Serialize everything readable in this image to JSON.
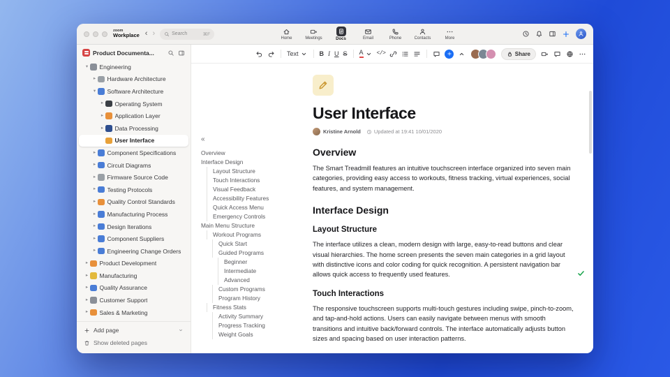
{
  "colors": {
    "accent": "#1a6ef5",
    "check_green": "#17a34a",
    "workspace_red": "#d64444"
  },
  "titlebar": {
    "logo_top": "zoom",
    "logo_bottom": "Workplace",
    "back_glyph": "‹",
    "forward_glyph": "›",
    "search_placeholder": "Search",
    "search_shortcut": "⌘F",
    "tabs": [
      {
        "label": "Home",
        "icon": "home",
        "active": false
      },
      {
        "label": "Meetings",
        "icon": "video",
        "active": false
      },
      {
        "label": "Docs",
        "icon": "doc",
        "active": true
      },
      {
        "label": "Email",
        "icon": "email",
        "active": false
      },
      {
        "label": "Phone",
        "icon": "phone",
        "active": false
      },
      {
        "label": "Contacts",
        "icon": "person",
        "active": false
      },
      {
        "label": "More",
        "icon": "dots",
        "active": false
      }
    ]
  },
  "sidebar": {
    "workspace_title": "Product Documenta...",
    "tree": [
      {
        "label": "Engineering",
        "level": 0,
        "chevron": "expanded",
        "color": "#8a8f98"
      },
      {
        "label": "Hardware Architecture",
        "level": 1,
        "chevron": "collapsed",
        "color": "#9aa0a6"
      },
      {
        "label": "Software Architecture",
        "level": 1,
        "chevron": "expanded",
        "color": "#4a7dd6"
      },
      {
        "label": "Operating System",
        "level": 2,
        "chevron": "collapsed",
        "color": "#3b3f45"
      },
      {
        "label": "Application Layer",
        "level": 2,
        "chevron": "collapsed",
        "color": "#e8903a"
      },
      {
        "label": "Data Processing",
        "level": 2,
        "chevron": "collapsed",
        "color": "#2f4f8f"
      },
      {
        "label": "User Interface",
        "level": 2,
        "chevron": "none",
        "color": "#e8a13a",
        "selected": true
      },
      {
        "label": "Component Specifications",
        "level": 1,
        "chevron": "collapsed",
        "color": "#4a7dd6"
      },
      {
        "label": "Circuit Diagrams",
        "level": 1,
        "chevron": "collapsed",
        "color": "#4a7dd6"
      },
      {
        "label": "Firmware Source Code",
        "level": 1,
        "chevron": "collapsed",
        "color": "#9aa0a6"
      },
      {
        "label": "Testing Protocols",
        "level": 1,
        "chevron": "collapsed",
        "color": "#4a7dd6"
      },
      {
        "label": "Quality Control Standards",
        "level": 1,
        "chevron": "collapsed",
        "color": "#e8903a"
      },
      {
        "label": "Manufacturing Process",
        "level": 1,
        "chevron": "collapsed",
        "color": "#4a7dd6"
      },
      {
        "label": "Design Iterations",
        "level": 1,
        "chevron": "collapsed",
        "color": "#4a7dd6"
      },
      {
        "label": "Component Suppliers",
        "level": 1,
        "chevron": "collapsed",
        "color": "#4a7dd6"
      },
      {
        "label": "Engineering Change Orders",
        "level": 1,
        "chevron": "collapsed",
        "color": "#4a7dd6"
      },
      {
        "label": "Product Development",
        "level": 0,
        "chevron": "collapsed",
        "color": "#e8903a"
      },
      {
        "label": "Manufacturing",
        "level": 0,
        "chevron": "collapsed",
        "color": "#e3b93c"
      },
      {
        "label": "Quality Assurance",
        "level": 0,
        "chevron": "collapsed",
        "color": "#4a7dd6"
      },
      {
        "label": "Customer Support",
        "level": 0,
        "chevron": "collapsed",
        "color": "#8a8f98"
      },
      {
        "label": "Sales & Marketing",
        "level": 0,
        "chevron": "collapsed",
        "color": "#e8903a"
      }
    ],
    "add_page": "Add page",
    "show_deleted": "Show deleted pages"
  },
  "toolbar": {
    "share_label": "Share",
    "avatars": [
      "#9a6b4f",
      "#7b8794",
      "#d48fb0"
    ],
    "left_items": [
      {
        "name": "undo",
        "icon": "undo"
      },
      {
        "name": "redo",
        "icon": "redo"
      },
      {
        "name": "divider"
      },
      {
        "name": "text-style",
        "text": "Text",
        "icon": "caret"
      },
      {
        "name": "divider"
      },
      {
        "name": "bold",
        "text": "B",
        "style": "bold"
      },
      {
        "name": "italic",
        "text": "I",
        "style": "italic"
      },
      {
        "name": "underline",
        "text": "U",
        "style": "underline"
      },
      {
        "name": "strikethrough",
        "text": "S",
        "style": "strike"
      },
      {
        "name": "divider"
      },
      {
        "name": "text-color",
        "text": "A",
        "icon": "caret",
        "style": "color"
      },
      {
        "name": "code",
        "text": "</>",
        "style": "codebtn"
      },
      {
        "name": "link",
        "icon": "link"
      },
      {
        "name": "bullet-list",
        "icon": "list"
      },
      {
        "name": "align",
        "icon": "align"
      },
      {
        "name": "divider"
      },
      {
        "name": "comment",
        "icon": "comment"
      },
      {
        "name": "insert",
        "icon": "plus",
        "style": "plusbtn"
      },
      {
        "name": "collapse-toolbar",
        "icon": "chevup"
      }
    ]
  },
  "outline": {
    "collapse_glyph": "«",
    "items": [
      {
        "label": "Overview",
        "level": 0
      },
      {
        "label": "Interface Design",
        "level": 0
      },
      {
        "label": "Layout Structure",
        "level": 1
      },
      {
        "label": "Touch Interactions",
        "level": 1
      },
      {
        "label": "Visual Feedback",
        "level": 1
      },
      {
        "label": "Accessibility Features",
        "level": 1
      },
      {
        "label": "Quick Access Menu",
        "level": 1
      },
      {
        "label": "Emergency Controls",
        "level": 1
      },
      {
        "label": "Main Menu Structure",
        "level": 0
      },
      {
        "label": "Workout Programs",
        "level": 1
      },
      {
        "label": "Quick Start",
        "level": 2
      },
      {
        "label": "Guided Programs",
        "level": 2
      },
      {
        "label": "Beginner",
        "level": 3
      },
      {
        "label": "Intermediate",
        "level": 3
      },
      {
        "label": "Advanced",
        "level": 3
      },
      {
        "label": "Custom Programs",
        "level": 2
      },
      {
        "label": "Program History",
        "level": 2
      },
      {
        "label": "Fitness Stats",
        "level": 1
      },
      {
        "label": "Activity Summary",
        "level": 2
      },
      {
        "label": "Progress Tracking",
        "level": 2
      },
      {
        "label": "Weight Goals",
        "level": 2
      }
    ]
  },
  "document": {
    "title": "User Interface",
    "author": "Kristine Arnold",
    "updated": "Updated at 19:41 10/01/2020",
    "blocks": [
      {
        "type": "h1",
        "text": "Overview"
      },
      {
        "type": "p",
        "text": "The Smart Treadmill features an intuitive touchscreen interface organized into seven main categories, providing easy access to workouts, fitness tracking, virtual experiences, social features, and system management."
      },
      {
        "type": "h1",
        "text": "Interface Design"
      },
      {
        "type": "h2",
        "text": "Layout Structure"
      },
      {
        "type": "p",
        "resolved_check": true,
        "text": "The interface utilizes a clean, modern design with large, easy-to-read buttons and clear visual hierarchies. The home screen presents the seven main categories in a grid layout with distinctive icons and color coding for quick recognition. A persistent navigation bar allows quick access to frequently used features."
      },
      {
        "type": "h2",
        "text": "Touch Interactions"
      },
      {
        "type": "p",
        "text": "The responsive touchscreen supports multi-touch gestures including swipe, pinch-to-zoom, and tap-and-hold actions. Users can easily navigate between menus with smooth transitions and intuitive back/forward controls. The interface automatically adjusts button sizes and spacing based on user interaction patterns."
      }
    ]
  }
}
